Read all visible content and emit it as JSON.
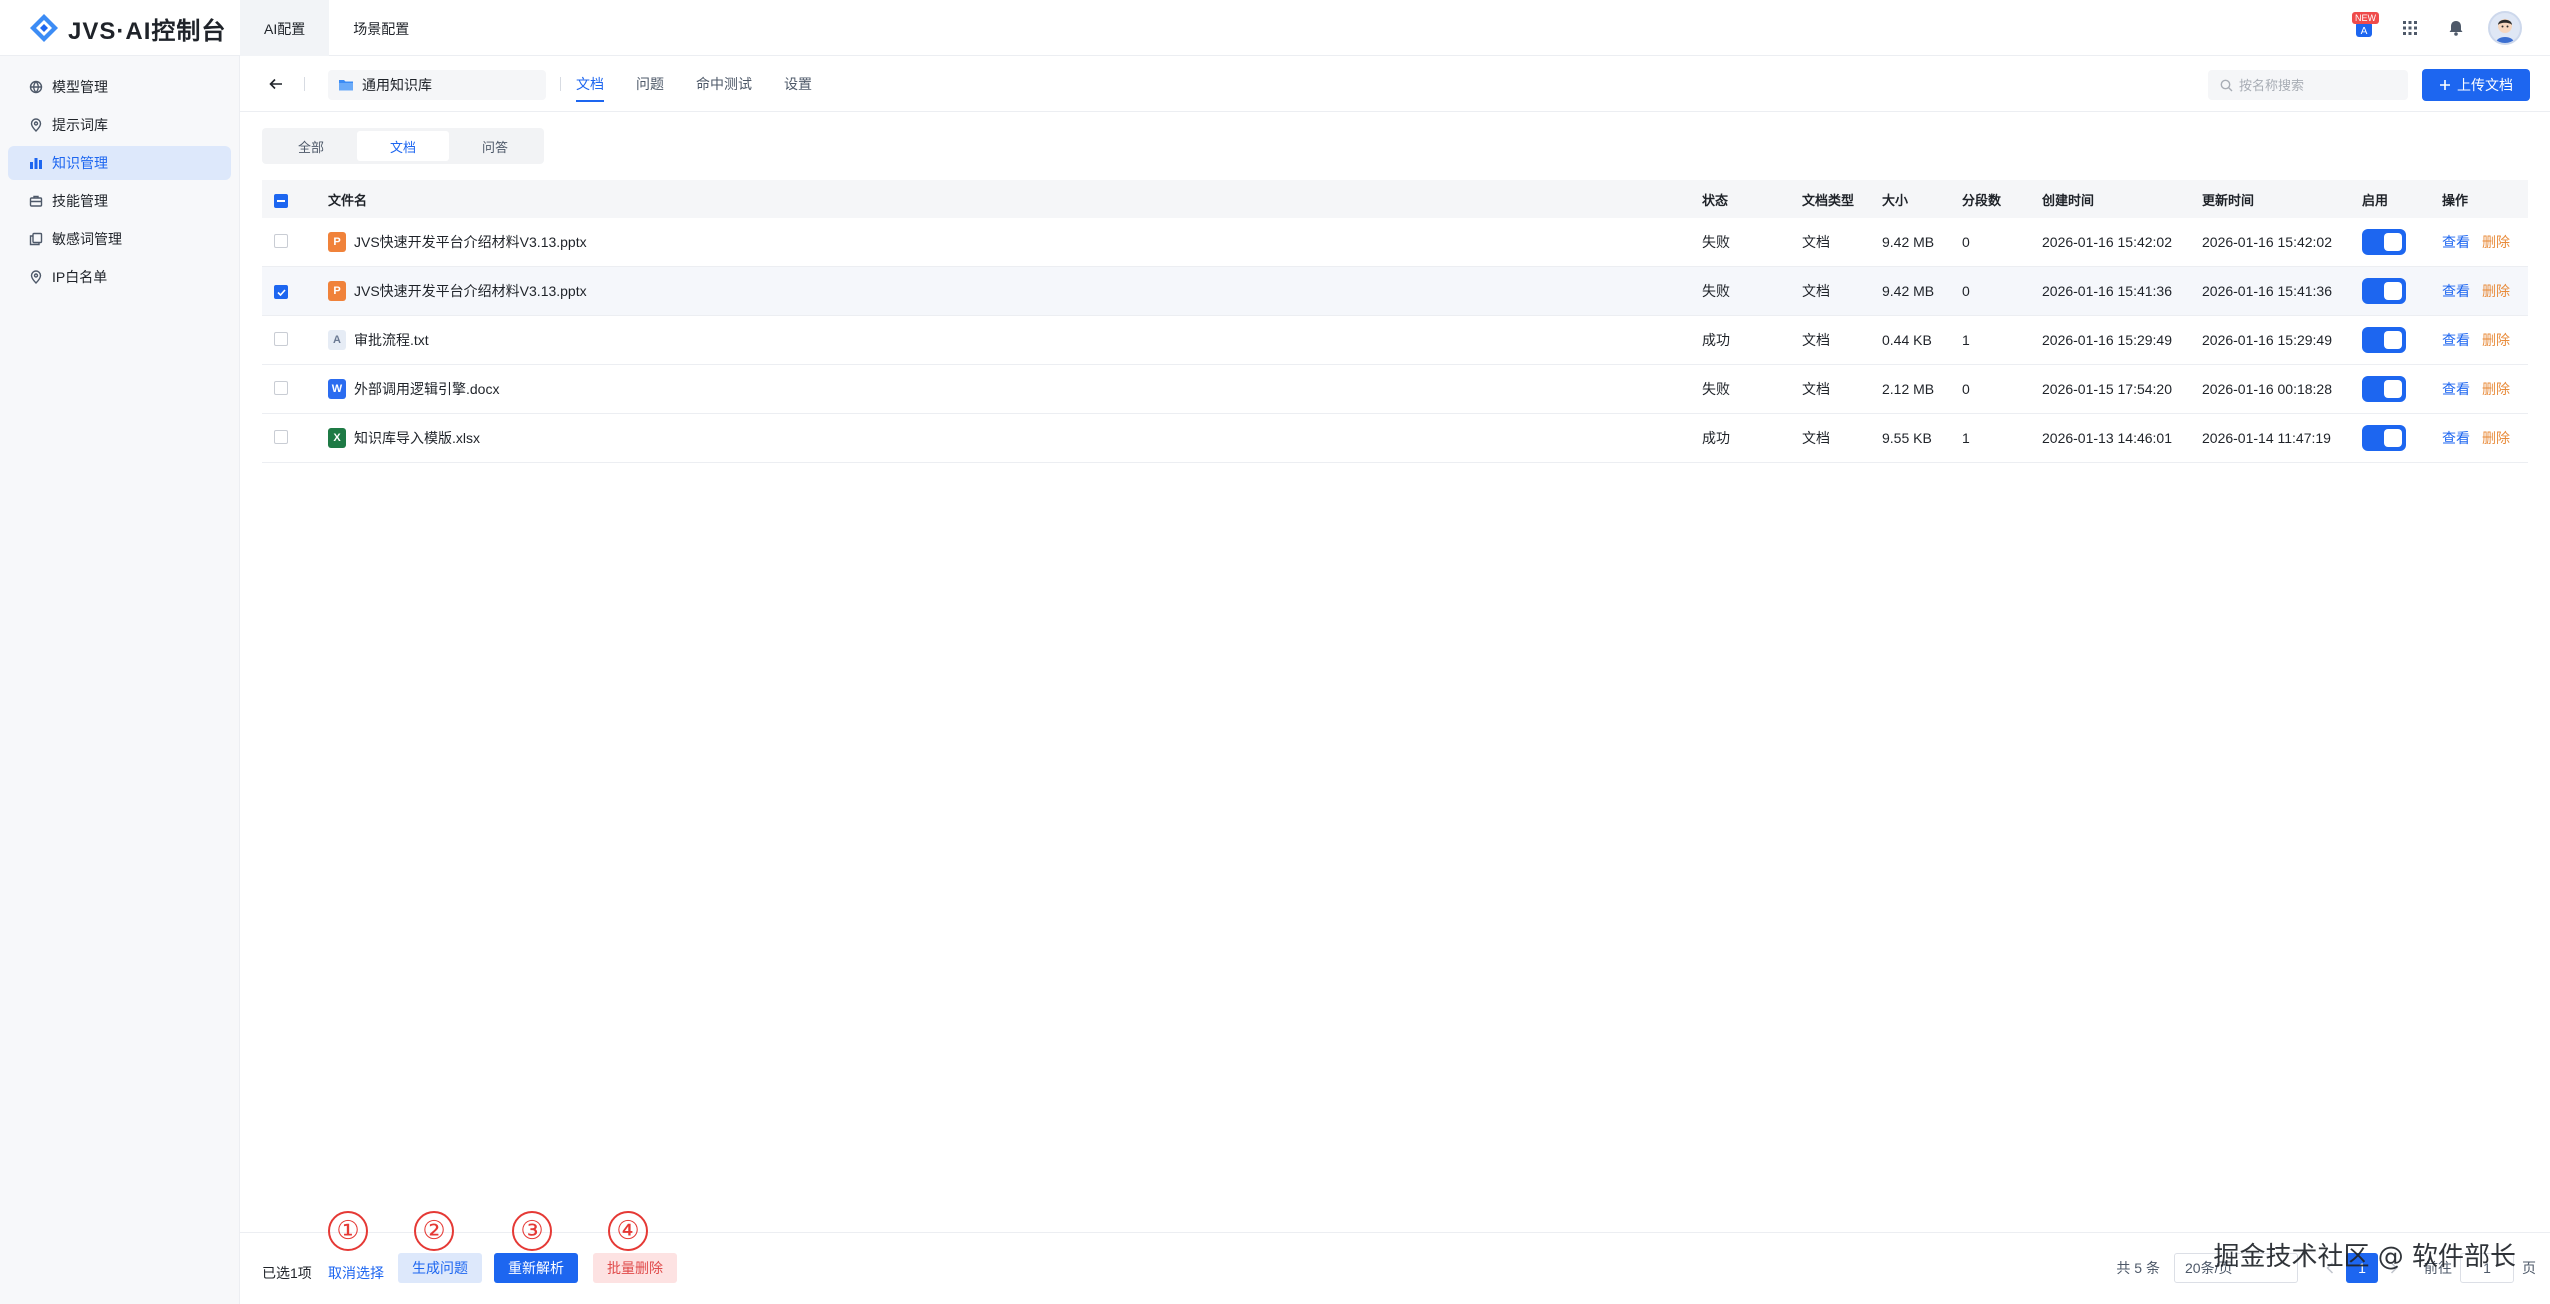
{
  "header": {
    "logo_text": "JVS·AI控制台",
    "tabs": [
      {
        "label": "AI配置",
        "active": true
      },
      {
        "label": "场景配置",
        "active": false
      }
    ],
    "new_badge": "NEW",
    "icons": [
      "translate-icon",
      "apps-grid-icon",
      "bell-icon",
      "avatar"
    ]
  },
  "sidebar": {
    "items": [
      {
        "label": "模型管理",
        "icon": "model-icon",
        "active": false
      },
      {
        "label": "提示词库",
        "icon": "pin-icon",
        "active": false
      },
      {
        "label": "知识管理",
        "icon": "chart-bars-icon",
        "active": true
      },
      {
        "label": "技能管理",
        "icon": "toolbox-icon",
        "active": false
      },
      {
        "label": "敏感词管理",
        "icon": "document-copy-icon",
        "active": false
      },
      {
        "label": "IP白名单",
        "icon": "pin-icon",
        "active": false
      }
    ]
  },
  "subbar": {
    "knowledge_base": "通用知识库",
    "tabs": [
      {
        "label": "文档",
        "active": true
      },
      {
        "label": "问题",
        "active": false
      },
      {
        "label": "命中测试",
        "active": false
      },
      {
        "label": "设置",
        "active": false
      }
    ],
    "search_placeholder": "按名称搜索",
    "upload_label": "上传文档"
  },
  "filter": {
    "options": [
      {
        "label": "全部",
        "active": false
      },
      {
        "label": "文档",
        "active": true
      },
      {
        "label": "问答",
        "active": false
      }
    ]
  },
  "table": {
    "columns": [
      "文件名",
      "状态",
      "文档类型",
      "大小",
      "分段数",
      "创建时间",
      "更新时间",
      "启用",
      "操作"
    ],
    "rows": [
      {
        "file_icon": "pptx",
        "name": "JVS快速开发平台介绍材料V3.13.pptx",
        "status": "失败",
        "type": "文档",
        "size": "9.42 MB",
        "segments": "0",
        "created": "2026-01-16 15:42:02",
        "updated": "2026-01-16 15:42:02",
        "enabled": true,
        "checked": false
      },
      {
        "file_icon": "pptx",
        "name": "JVS快速开发平台介绍材料V3.13.pptx",
        "status": "失败",
        "type": "文档",
        "size": "9.42 MB",
        "segments": "0",
        "created": "2026-01-16 15:41:36",
        "updated": "2026-01-16 15:41:36",
        "enabled": true,
        "checked": true
      },
      {
        "file_icon": "txt",
        "name": "审批流程.txt",
        "status": "成功",
        "type": "文档",
        "size": "0.44 KB",
        "segments": "1",
        "created": "2026-01-16 15:29:49",
        "updated": "2026-01-16 15:29:49",
        "enabled": true,
        "checked": false
      },
      {
        "file_icon": "docx",
        "name": "外部调用逻辑引擎.docx",
        "status": "失败",
        "type": "文档",
        "size": "2.12 MB",
        "segments": "0",
        "created": "2026-01-15 17:54:20",
        "updated": "2026-01-16 00:18:28",
        "enabled": true,
        "checked": false
      },
      {
        "file_icon": "xlsx",
        "name": "知识库导入模版.xlsx",
        "status": "成功",
        "type": "文档",
        "size": "9.55 KB",
        "segments": "1",
        "created": "2026-01-13 14:46:01",
        "updated": "2026-01-14 11:47:19",
        "enabled": true,
        "checked": false
      }
    ],
    "view_label": "查看",
    "delete_label": "删除"
  },
  "footer": {
    "selected_info": "已选1项",
    "cancel_label": "取消选择",
    "generate_label": "生成问题",
    "reparse_label": "重新解析",
    "bulk_delete_label": "批量删除",
    "markers": [
      "①",
      "②",
      "③",
      "④"
    ],
    "total": "共 5 条",
    "page_size": "20条/页",
    "current_page": "1",
    "goto_label": "前往",
    "goto_value": "1",
    "page_unit": "页"
  },
  "watermark": "掘金技术社区 @ 软件部长",
  "colors": {
    "primary": "#1d66f0",
    "danger": "#e04b4b",
    "warning": "#e88b3a",
    "marker": "#e53935"
  }
}
